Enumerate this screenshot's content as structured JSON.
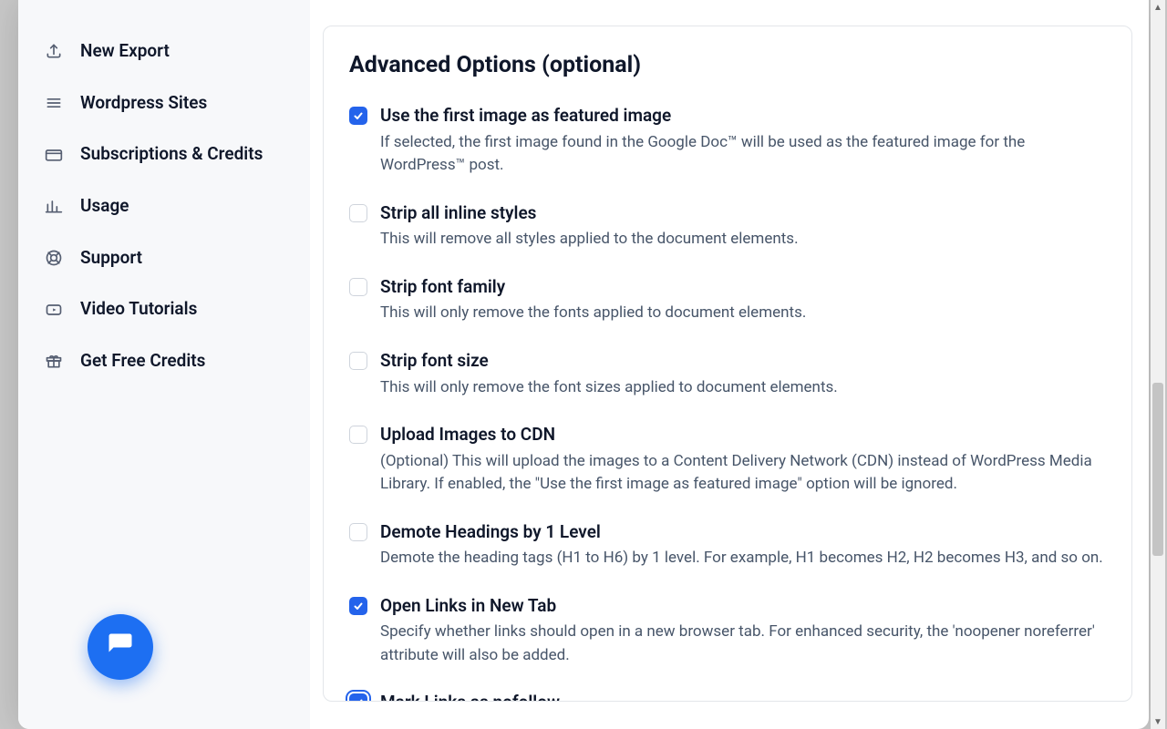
{
  "sidebar": {
    "items": [
      {
        "label": "New Export",
        "icon": "upload-icon"
      },
      {
        "label": "Wordpress Sites",
        "icon": "list-icon"
      },
      {
        "label": "Subscriptions & Credits",
        "icon": "card-icon"
      },
      {
        "label": "Usage",
        "icon": "chart-icon"
      },
      {
        "label": "Support",
        "icon": "lifebuoy-icon"
      },
      {
        "label": "Video Tutorials",
        "icon": "video-icon"
      },
      {
        "label": "Get Free Credits",
        "icon": "gift-icon"
      }
    ]
  },
  "panel": {
    "title": "Advanced Options (optional)",
    "options": [
      {
        "title": "Use the first image as featured image",
        "desc": "If selected, the first image found in the Google Doc™ will be used as the featured image for the WordPress™ post.",
        "checked": true,
        "focused": false
      },
      {
        "title": "Strip all inline styles",
        "desc": "This will remove all styles applied to the document elements.",
        "checked": false,
        "focused": false
      },
      {
        "title": "Strip font family",
        "desc": "This will only remove the fonts applied to document elements.",
        "checked": false,
        "focused": false
      },
      {
        "title": "Strip font size",
        "desc": "This will only remove the font sizes applied to document elements.",
        "checked": false,
        "focused": false
      },
      {
        "title": "Upload Images to CDN",
        "desc": "(Optional) This will upload the images to a Content Delivery Network (CDN) instead of WordPress Media Library. If enabled, the \"Use the first image as featured image\" option will be ignored.",
        "checked": false,
        "focused": false
      },
      {
        "title": "Demote Headings by 1 Level",
        "desc": "Demote the heading tags (H1 to H6) by 1 level. For example, H1 becomes H2, H2 becomes H3, and so on.",
        "checked": false,
        "focused": false
      },
      {
        "title": "Open Links in New Tab",
        "desc": "Specify whether links should open in a new browser tab. For enhanced security, the 'noopener noreferrer' attribute will also be added.",
        "checked": true,
        "focused": false
      },
      {
        "title": "Mark Links as nofollow",
        "desc": "",
        "checked": true,
        "focused": true
      }
    ]
  }
}
